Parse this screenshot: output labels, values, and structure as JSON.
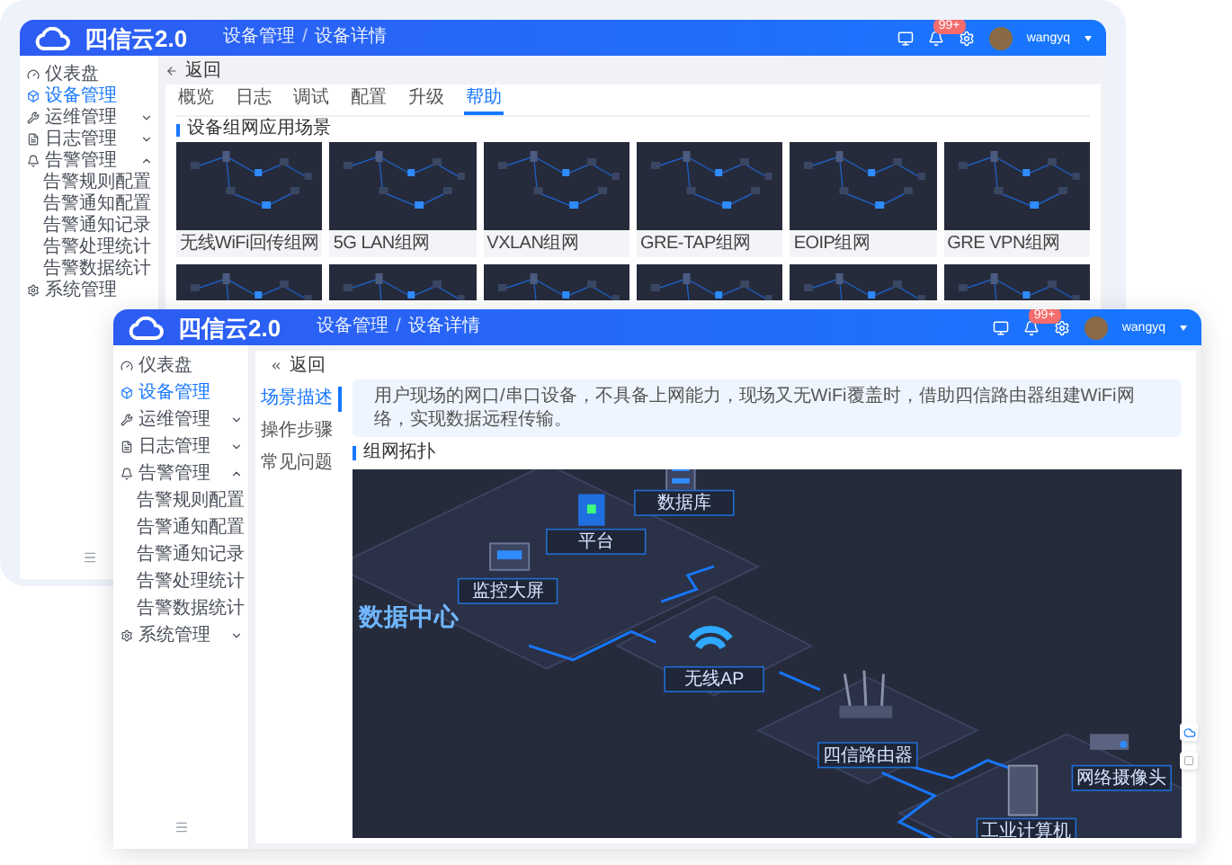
{
  "back_window": {
    "brand": "四信云2.0",
    "breadcrumb": [
      "设备管理",
      "设备详情"
    ],
    "breadcrumb_separator": "/",
    "notification_badge": "99+",
    "username": "wangyq",
    "sidebar": [
      {
        "label": "仪表盘",
        "selected": false
      },
      {
        "label": "设备管理",
        "selected": true
      },
      {
        "label": "运维管理",
        "selected": false,
        "expanded": false
      },
      {
        "label": "日志管理",
        "selected": false,
        "expanded": false
      },
      {
        "label": "告警管理",
        "selected": false,
        "expanded": true,
        "children": [
          {
            "label": "告警规则配置",
            "selected": false
          },
          {
            "label": "告警通知配置",
            "selected": false
          },
          {
            "label": "告警通知记录",
            "selected": false
          },
          {
            "label": "告警处理统计",
            "selected": false
          },
          {
            "label": "告警数据统计",
            "selected": false
          }
        ]
      },
      {
        "label": "系统管理",
        "selected": false
      }
    ],
    "back_link": "返回",
    "tabs": [
      {
        "label": "概览",
        "selected": false
      },
      {
        "label": "日志",
        "selected": false
      },
      {
        "label": "调试",
        "selected": false
      },
      {
        "label": "配置",
        "selected": false
      },
      {
        "label": "升级",
        "selected": false
      },
      {
        "label": "帮助",
        "selected": true
      }
    ],
    "section_title": "设备组网应用场景",
    "scenarios": [
      {
        "label": "无线WiFi回传组网"
      },
      {
        "label": "5G LAN组网"
      },
      {
        "label": "VXLAN组网"
      },
      {
        "label": "GRE-TAP组网"
      },
      {
        "label": "EOIP组网"
      },
      {
        "label": "GRE VPN组网"
      }
    ]
  },
  "front_window": {
    "brand": "四信云2.0",
    "breadcrumb": [
      "设备管理",
      "设备详情"
    ],
    "breadcrumb_separator": "/",
    "notification_badge": "99+",
    "username": "wangyq",
    "sidebar": [
      {
        "label": "仪表盘",
        "selected": false
      },
      {
        "label": "设备管理",
        "selected": true
      },
      {
        "label": "运维管理",
        "selected": false,
        "expanded": false
      },
      {
        "label": "日志管理",
        "selected": false,
        "expanded": false
      },
      {
        "label": "告警管理",
        "selected": false,
        "expanded": true,
        "children": [
          {
            "label": "告警规则配置",
            "selected": false
          },
          {
            "label": "告警通知配置",
            "selected": false
          },
          {
            "label": "告警通知记录",
            "selected": false
          },
          {
            "label": "告警处理统计",
            "selected": false
          },
          {
            "label": "告警数据统计",
            "selected": false
          }
        ]
      },
      {
        "label": "系统管理",
        "selected": false,
        "expanded": false
      }
    ],
    "back_link": "返回",
    "side_tabs": [
      {
        "label": "场景描述",
        "selected": true
      },
      {
        "label": "操作步骤",
        "selected": false
      },
      {
        "label": "常见问题",
        "selected": false
      }
    ],
    "description": "用户现场的网口/串口设备，不具备上网能力，现场又无WiFi覆盖时，借助四信路由器组建WiFi网络，实现数据远程传输。",
    "topology": {
      "title": "组网拓扑",
      "labels": [
        "数据中心",
        "监控大屏",
        "平台",
        "数据库",
        "无线AP",
        "四信路由器",
        "工业计算机",
        "网络摄像头"
      ]
    }
  }
}
